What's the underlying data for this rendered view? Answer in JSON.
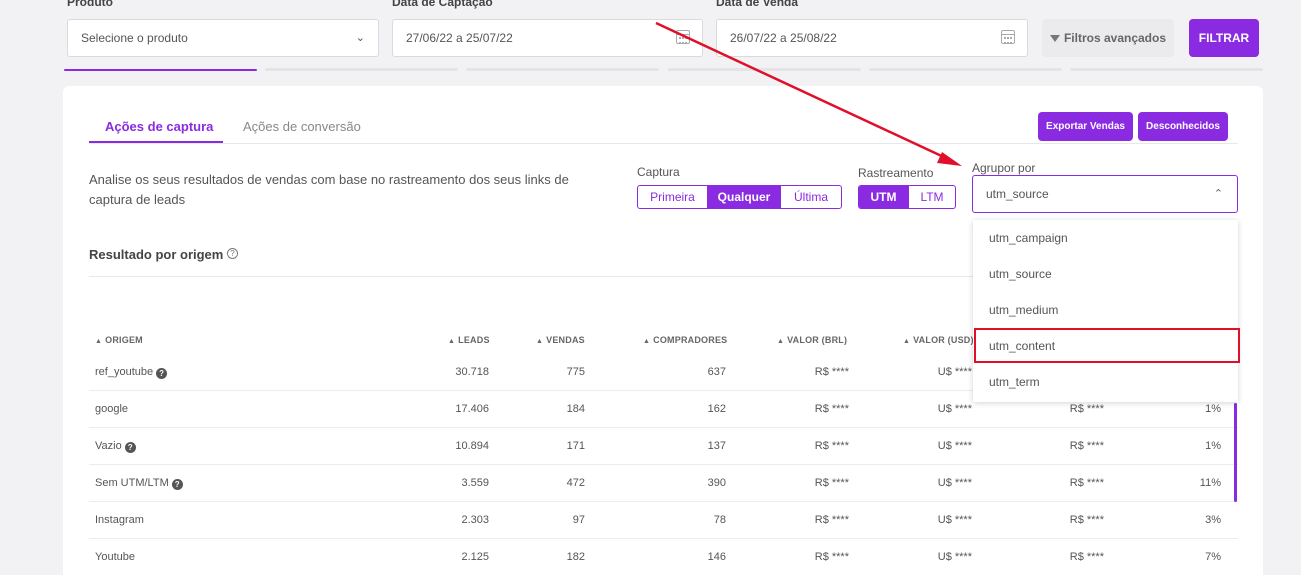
{
  "filters": {
    "product_label": "Produto",
    "product_placeholder": "Selecione o produto",
    "capture_date_label": "Data de Captação",
    "capture_date_value": "27/06/22 a 25/07/22",
    "sale_date_label": "Data de Venda",
    "sale_date_value": "26/07/22 a 25/08/22",
    "advanced_label": "Filtros avançados",
    "apply_label": "FILTRAR"
  },
  "tabs": [
    {
      "label": "Ações de captura",
      "active": true
    },
    {
      "label": "Ações de conversão",
      "active": false
    }
  ],
  "actions": {
    "export_label": "Exportar Vendas",
    "unknown_label": "Desconhecidos"
  },
  "description": "Analise os seus resultados de vendas com base no rastreamento dos seus links de captura de leads",
  "capture": {
    "label": "Captura",
    "options": [
      "Primeira",
      "Qualquer",
      "Última"
    ],
    "selected": "Qualquer"
  },
  "tracking": {
    "label": "Rastreamento",
    "options": [
      "UTM",
      "LTM"
    ],
    "selected": "UTM"
  },
  "group_by": {
    "label": "Agrupor por",
    "selected": "utm_source",
    "options": [
      "utm_campaign",
      "utm_source",
      "utm_medium",
      "utm_content",
      "utm_term"
    ],
    "highlighted": "utm_content"
  },
  "section": {
    "title": "Resultado por origem",
    "help_glyph": "?"
  },
  "table": {
    "columns": [
      "ORIGEM",
      "LEADS",
      "VENDAS",
      "COMPRADORES",
      "VALOR (BRL)",
      "VALOR (USD)"
    ],
    "rows": [
      {
        "origin": "ref_youtube",
        "help": true,
        "leads": "30.718",
        "sales": "775",
        "buyers": "637",
        "brl": "R$ ****",
        "usd": "U$ ****",
        "extra": "",
        "pct": ""
      },
      {
        "origin": "google",
        "help": false,
        "leads": "17.406",
        "sales": "184",
        "buyers": "162",
        "brl": "R$ ****",
        "usd": "U$ ****",
        "extra": "R$ ****",
        "pct": "1%"
      },
      {
        "origin": "Vazio",
        "help": true,
        "leads": "10.894",
        "sales": "171",
        "buyers": "137",
        "brl": "R$ ****",
        "usd": "U$ ****",
        "extra": "R$ ****",
        "pct": "1%"
      },
      {
        "origin": "Sem UTM/LTM",
        "help": true,
        "leads": "3.559",
        "sales": "472",
        "buyers": "390",
        "brl": "R$ ****",
        "usd": "U$ ****",
        "extra": "R$ ****",
        "pct": "11%"
      },
      {
        "origin": "Instagram",
        "help": false,
        "leads": "2.303",
        "sales": "97",
        "buyers": "78",
        "brl": "R$ ****",
        "usd": "U$ ****",
        "extra": "R$ ****",
        "pct": "3%"
      },
      {
        "origin": "Youtube",
        "help": false,
        "leads": "2.125",
        "sales": "182",
        "buyers": "146",
        "brl": "R$ ****",
        "usd": "U$ ****",
        "extra": "R$ ****",
        "pct": "7%"
      }
    ]
  },
  "colors": {
    "accent": "#8a2be2",
    "annotation": "#e0102a"
  }
}
